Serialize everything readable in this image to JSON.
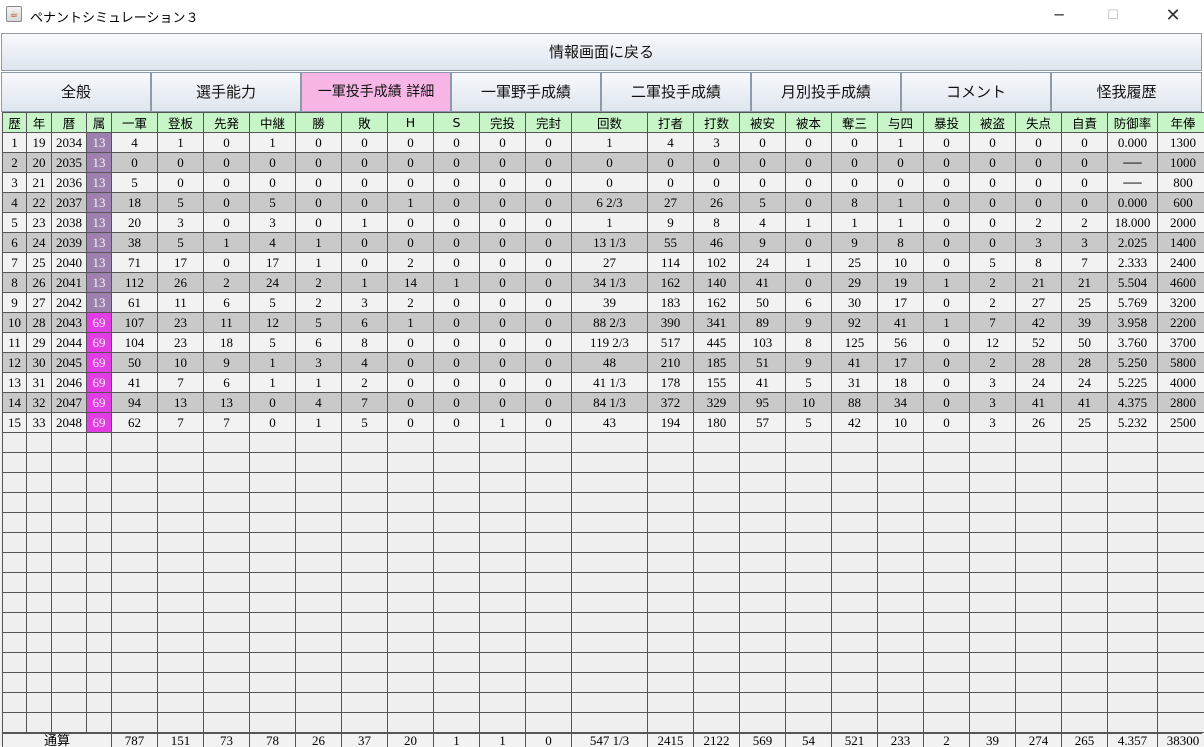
{
  "window": {
    "title": "ペナントシミュレーション３",
    "icon": "java-coffee-cup-icon",
    "controls": [
      "minimize-icon",
      "maximize-icon",
      "close-icon"
    ]
  },
  "back_button_label": "情報画面に戻る",
  "tabs": [
    {
      "label": "全般",
      "active": false
    },
    {
      "label": "選手能力",
      "active": false
    },
    {
      "label": "一軍投手成績 詳細",
      "active": true
    },
    {
      "label": "一軍野手成績",
      "active": false
    },
    {
      "label": "二軍投手成績",
      "active": false
    },
    {
      "label": "月別投手成績",
      "active": false
    },
    {
      "label": "コメント",
      "active": false
    },
    {
      "label": "怪我履歴",
      "active": false
    }
  ],
  "colors": {
    "header_bg": "#c8f5c8",
    "active_tab_bg": "#f7b6e6",
    "team_13_bg": "#9d80ad",
    "team_69_bg": "#e43ce4",
    "row_odd_bg": "#f2f2f2",
    "row_even_bg": "#c9c9c9"
  },
  "columns": [
    "歴",
    "年",
    "暦",
    "属",
    "一軍",
    "登板",
    "先発",
    "中継",
    "勝",
    "敗",
    "H",
    "S",
    "完投",
    "完封",
    "回数",
    "打者",
    "打数",
    "被安",
    "被本",
    "奪三",
    "与四",
    "暴投",
    "被盗",
    "失点",
    "自責",
    "防御率",
    "年俸"
  ],
  "rows": [
    [
      "1",
      "19",
      "2034",
      "13",
      "4",
      "1",
      "0",
      "1",
      "0",
      "0",
      "0",
      "0",
      "0",
      "0",
      "1",
      "4",
      "3",
      "0",
      "0",
      "0",
      "1",
      "0",
      "0",
      "0",
      "0",
      "0.000",
      "1300"
    ],
    [
      "2",
      "20",
      "2035",
      "13",
      "0",
      "0",
      "0",
      "0",
      "0",
      "0",
      "0",
      "0",
      "0",
      "0",
      "0",
      "0",
      "0",
      "0",
      "0",
      "0",
      "0",
      "0",
      "0",
      "0",
      "0",
      "──",
      "1000"
    ],
    [
      "3",
      "21",
      "2036",
      "13",
      "5",
      "0",
      "0",
      "0",
      "0",
      "0",
      "0",
      "0",
      "0",
      "0",
      "0",
      "0",
      "0",
      "0",
      "0",
      "0",
      "0",
      "0",
      "0",
      "0",
      "0",
      "──",
      "800"
    ],
    [
      "4",
      "22",
      "2037",
      "13",
      "18",
      "5",
      "0",
      "5",
      "0",
      "0",
      "1",
      "0",
      "0",
      "0",
      "6 2/3",
      "27",
      "26",
      "5",
      "0",
      "8",
      "1",
      "0",
      "0",
      "0",
      "0",
      "0.000",
      "600"
    ],
    [
      "5",
      "23",
      "2038",
      "13",
      "20",
      "3",
      "0",
      "3",
      "0",
      "1",
      "0",
      "0",
      "0",
      "0",
      "1",
      "9",
      "8",
      "4",
      "1",
      "1",
      "1",
      "0",
      "0",
      "2",
      "2",
      "18.000",
      "2000"
    ],
    [
      "6",
      "24",
      "2039",
      "13",
      "38",
      "5",
      "1",
      "4",
      "1",
      "0",
      "0",
      "0",
      "0",
      "0",
      "13 1/3",
      "55",
      "46",
      "9",
      "0",
      "9",
      "8",
      "0",
      "0",
      "3",
      "3",
      "2.025",
      "1400"
    ],
    [
      "7",
      "25",
      "2040",
      "13",
      "71",
      "17",
      "0",
      "17",
      "1",
      "0",
      "2",
      "0",
      "0",
      "0",
      "27",
      "114",
      "102",
      "24",
      "1",
      "25",
      "10",
      "0",
      "5",
      "8",
      "7",
      "2.333",
      "2400"
    ],
    [
      "8",
      "26",
      "2041",
      "13",
      "112",
      "26",
      "2",
      "24",
      "2",
      "1",
      "14",
      "1",
      "0",
      "0",
      "34 1/3",
      "162",
      "140",
      "41",
      "0",
      "29",
      "19",
      "1",
      "2",
      "21",
      "21",
      "5.504",
      "4600"
    ],
    [
      "9",
      "27",
      "2042",
      "13",
      "61",
      "11",
      "6",
      "5",
      "2",
      "3",
      "2",
      "0",
      "0",
      "0",
      "39",
      "183",
      "162",
      "50",
      "6",
      "30",
      "17",
      "0",
      "2",
      "27",
      "25",
      "5.769",
      "3200"
    ],
    [
      "10",
      "28",
      "2043",
      "69",
      "107",
      "23",
      "11",
      "12",
      "5",
      "6",
      "1",
      "0",
      "0",
      "0",
      "88 2/3",
      "390",
      "341",
      "89",
      "9",
      "92",
      "41",
      "1",
      "7",
      "42",
      "39",
      "3.958",
      "2200"
    ],
    [
      "11",
      "29",
      "2044",
      "69",
      "104",
      "23",
      "18",
      "5",
      "6",
      "8",
      "0",
      "0",
      "0",
      "0",
      "119 2/3",
      "517",
      "445",
      "103",
      "8",
      "125",
      "56",
      "0",
      "12",
      "52",
      "50",
      "3.760",
      "3700"
    ],
    [
      "12",
      "30",
      "2045",
      "69",
      "50",
      "10",
      "9",
      "1",
      "3",
      "4",
      "0",
      "0",
      "0",
      "0",
      "48",
      "210",
      "185",
      "51",
      "9",
      "41",
      "17",
      "0",
      "2",
      "28",
      "28",
      "5.250",
      "5800"
    ],
    [
      "13",
      "31",
      "2046",
      "69",
      "41",
      "7",
      "6",
      "1",
      "1",
      "2",
      "0",
      "0",
      "0",
      "0",
      "41 1/3",
      "178",
      "155",
      "41",
      "5",
      "31",
      "18",
      "0",
      "3",
      "24",
      "24",
      "5.225",
      "4000"
    ],
    [
      "14",
      "32",
      "2047",
      "69",
      "94",
      "13",
      "13",
      "0",
      "4",
      "7",
      "0",
      "0",
      "0",
      "0",
      "84 1/3",
      "372",
      "329",
      "95",
      "10",
      "88",
      "34",
      "0",
      "3",
      "41",
      "41",
      "4.375",
      "2800"
    ],
    [
      "15",
      "33",
      "2048",
      "69",
      "62",
      "7",
      "7",
      "0",
      "1",
      "5",
      "0",
      "0",
      "1",
      "0",
      "43",
      "194",
      "180",
      "57",
      "5",
      "42",
      "10",
      "0",
      "3",
      "26",
      "25",
      "5.232",
      "2500"
    ]
  ],
  "totals": {
    "label": "通算",
    "values": [
      "787",
      "151",
      "73",
      "78",
      "26",
      "37",
      "20",
      "1",
      "1",
      "0",
      "547 1/3",
      "2415",
      "2122",
      "569",
      "54",
      "521",
      "233",
      "2",
      "39",
      "274",
      "265",
      "4.357",
      "38300"
    ]
  }
}
